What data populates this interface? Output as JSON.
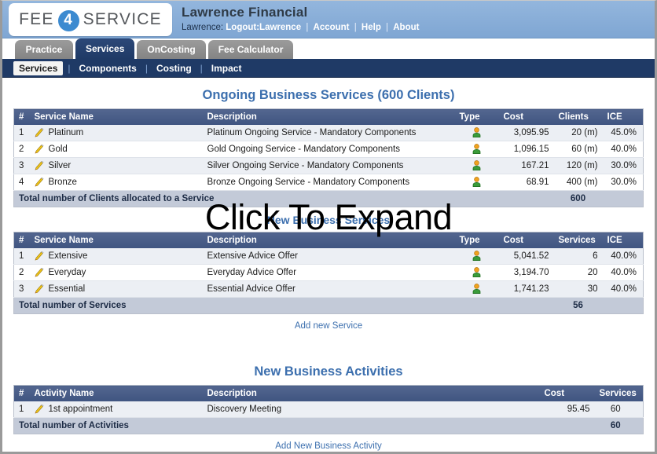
{
  "brand": {
    "logo_part1": "FEE",
    "logo_digit": "4",
    "logo_part2": "SERVICE",
    "accent_color": "#3c8ad0",
    "header_bg": "#8ab0da",
    "nav_bg": "#1f3a66"
  },
  "header": {
    "client_name": "Lawrence Financial",
    "user_prefix": "Lawrence:",
    "links": [
      {
        "label": "Logout:Lawrence"
      },
      {
        "label": "Account"
      },
      {
        "label": "Help"
      },
      {
        "label": "About"
      }
    ]
  },
  "tabs": [
    {
      "label": "Practice",
      "active": false
    },
    {
      "label": "Services",
      "active": true
    },
    {
      "label": "OnCosting",
      "active": false
    },
    {
      "label": "Fee Calculator",
      "active": false
    }
  ],
  "subnav": [
    {
      "label": "Services",
      "current": true
    },
    {
      "label": "Components",
      "current": false
    },
    {
      "label": "Costing",
      "current": false
    },
    {
      "label": "Impact",
      "current": false
    }
  ],
  "overlay": {
    "text": "Click To Expand"
  },
  "sections": {
    "ongoing": {
      "title": "Ongoing Business Services (600 Clients)",
      "columns": [
        "#",
        "Service Name",
        "Description",
        "Type",
        "Cost",
        "Clients",
        "ICE"
      ],
      "rows": [
        {
          "num": "1",
          "name": "Platinum",
          "desc": "Platinum Ongoing Service - Mandatory Components",
          "type": "person-icon",
          "cost": "3,095.95",
          "count": "20 (m)",
          "ice": "45.0%"
        },
        {
          "num": "2",
          "name": "Gold",
          "desc": "Gold Ongoing Service - Mandatory Components",
          "type": "person-icon",
          "cost": "1,096.15",
          "count": "60 (m)",
          "ice": "40.0%"
        },
        {
          "num": "3",
          "name": "Silver",
          "desc": "Silver Ongoing Service - Mandatory Components",
          "type": "person-icon",
          "cost": "167.21",
          "count": "120 (m)",
          "ice": "30.0%"
        },
        {
          "num": "4",
          "name": "Bronze",
          "desc": "Bronze Ongoing Service - Mandatory Components",
          "type": "person-icon",
          "cost": "68.91",
          "count": "400 (m)",
          "ice": "30.0%"
        }
      ],
      "total_label": "Total number of Clients allocated to a Service",
      "total_value": "600"
    },
    "new_services": {
      "title": "New Business Services",
      "columns": [
        "#",
        "Service Name",
        "Description",
        "Type",
        "Cost",
        "Services",
        "ICE"
      ],
      "rows": [
        {
          "num": "1",
          "name": "Extensive",
          "desc": "Extensive Advice Offer",
          "type": "person-icon",
          "cost": "5,041.52",
          "count": "6",
          "ice": "40.0%"
        },
        {
          "num": "2",
          "name": "Everyday",
          "desc": "Everyday Advice Offer",
          "type": "person-icon",
          "cost": "3,194.70",
          "count": "20",
          "ice": "40.0%"
        },
        {
          "num": "3",
          "name": "Essential",
          "desc": "Essential Advice Offer",
          "type": "person-icon",
          "cost": "1,741.23",
          "count": "30",
          "ice": "40.0%"
        }
      ],
      "total_label": "Total number of Services",
      "total_value": "56",
      "add_link": "Add new Service"
    },
    "new_activities": {
      "title": "New Business Activities",
      "columns": [
        "#",
        "Activity Name",
        "Description",
        "Cost",
        "Services"
      ],
      "rows": [
        {
          "num": "1",
          "name": "1st appointment",
          "desc": "Discovery Meeting",
          "cost": "95.45",
          "count": "60"
        }
      ],
      "total_label": "Total number of Activities",
      "total_value": "60",
      "add_link": "Add New Business Activity"
    }
  }
}
